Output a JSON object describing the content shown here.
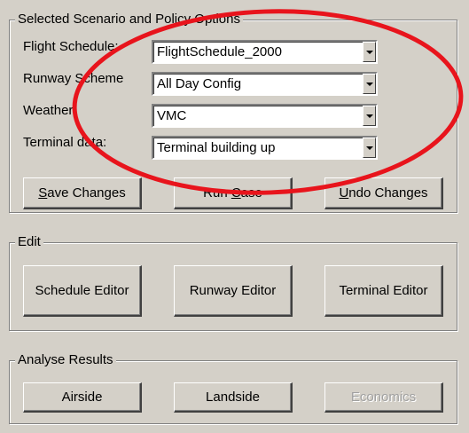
{
  "scenario": {
    "legend": "Selected Scenario and Policy Options",
    "fields": [
      {
        "label": "Flight Schedule:",
        "value": "FlightSchedule_2000"
      },
      {
        "label": "Runway Scheme",
        "value": "All Day Config"
      },
      {
        "label": "Weather:",
        "value": "VMC"
      },
      {
        "label": "Terminal data:",
        "value": "Terminal building up"
      }
    ],
    "buttons": {
      "save": {
        "pre": "",
        "key": "S",
        "post": "ave Changes"
      },
      "run": {
        "pre": "Run ",
        "key": "C",
        "post": "ase"
      },
      "undo": {
        "pre": "",
        "key": "U",
        "post": "ndo Changes"
      }
    }
  },
  "edit": {
    "legend": "Edit",
    "schedule_editor": "Schedule Editor",
    "runway_editor": "Runway Editor",
    "terminal_editor": "Terminal Editor"
  },
  "analyse": {
    "legend": "Analyse Results",
    "airside": "Airside",
    "landside": "Landside",
    "economics": "Economics"
  },
  "colors": {
    "window_bg": "#d4d0c8",
    "annotation_ring": "#e8141c",
    "disabled_text": "#a0a0a0"
  }
}
